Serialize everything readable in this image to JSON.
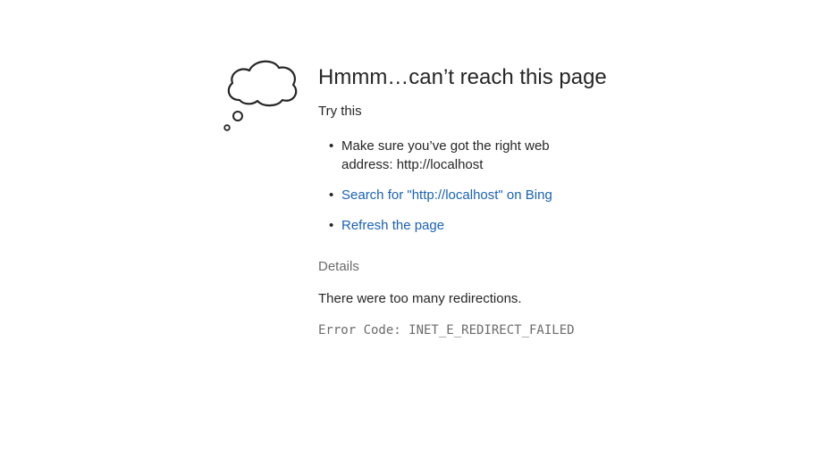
{
  "heading": "Hmmm…can’t reach this page",
  "try_this": "Try this",
  "suggestions": [
    {
      "text": "Make sure you’ve got the right web address: http://localhost"
    },
    {
      "text": "Search for \"http://localhost\" on Bing"
    },
    {
      "text": "Refresh the page"
    }
  ],
  "details": {
    "label": "Details",
    "message": "There were too many redirections.",
    "error_code": "Error Code: INET_E_REDIRECT_FAILED"
  },
  "icons": {
    "thought_cloud": "thought-cloud-icon"
  },
  "colors": {
    "link": "#1a62b5",
    "text": "#262626",
    "muted": "#6b6b6b"
  }
}
